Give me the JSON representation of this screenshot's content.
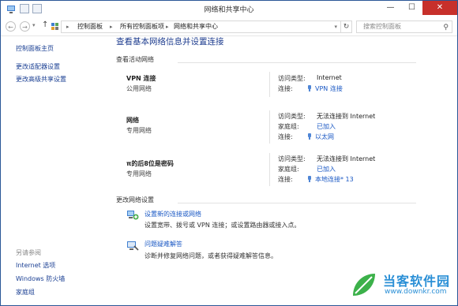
{
  "window": {
    "title": "网络和共享中心",
    "minimize_glyph": "—",
    "maximize_glyph": "☐",
    "close_glyph": "✕"
  },
  "nav": {
    "back_glyph": "←",
    "forward_glyph": "→",
    "up_glyph": "↑",
    "recent_glyph": "▾"
  },
  "address": {
    "crumbs": [
      "控制面板",
      "所有控制面板项",
      "网络和共享中心"
    ],
    "separator": "▸",
    "dropdown_glyph": "▾",
    "refresh_glyph": "↻"
  },
  "search": {
    "placeholder": "搜索控制面板",
    "icon": "search-icon",
    "glyph": "⚲"
  },
  "sidebar": {
    "items": [
      {
        "label": "控制面板主页"
      },
      {
        "label": "更改适配器设置"
      },
      {
        "label": "更改高级共享设置"
      }
    ],
    "see_also": {
      "title": "另请参阅",
      "items": [
        {
          "label": "Internet 选项"
        },
        {
          "label": "Windows 防火墙"
        },
        {
          "label": "家庭组"
        }
      ]
    }
  },
  "main": {
    "title": "查看基本网络信息并设置连接",
    "active_networks_header": "查看活动网络",
    "networks": [
      {
        "name": "VPN 连接",
        "type": "公用网络",
        "props": [
          {
            "label": "访问类型:",
            "value": "Internet",
            "link": false
          },
          {
            "label": "连接:",
            "value": "VPN 连接",
            "link": true,
            "icon": "connection-icon"
          }
        ]
      },
      {
        "name": "网络",
        "type": "专用网络",
        "props": [
          {
            "label": "访问类型:",
            "value": "无法连接到 Internet",
            "link": false
          },
          {
            "label": "家庭组:",
            "value": "已加入",
            "link": true
          },
          {
            "label": "连接:",
            "value": "以太网",
            "link": true,
            "icon": "connection-icon"
          }
        ]
      },
      {
        "name": "π的后8位是密码",
        "type": "专用网络",
        "props": [
          {
            "label": "访问类型:",
            "value": "无法连接到 Internet",
            "link": false
          },
          {
            "label": "家庭组:",
            "value": "已加入",
            "link": true
          },
          {
            "label": "连接:",
            "value": "本地连接* 13",
            "link": true,
            "icon": "connection-icon"
          }
        ]
      }
    ],
    "change_settings_header": "更改网络设置",
    "tasks": [
      {
        "link": "设置新的连接或网络",
        "desc": "设置宽带、拨号或 VPN 连接；或设置路由器或接入点。",
        "icon": "network-setup-icon"
      },
      {
        "link": "问题疑难解答",
        "desc": "诊断并修复网络问题，或者获得疑难解答信息。",
        "icon": "troubleshoot-icon"
      }
    ]
  },
  "watermark": {
    "name": "当客软件园",
    "url": "www.downkr.com"
  },
  "colors": {
    "link": "#1a58c4",
    "title_blue": "#1e3d8f",
    "close_red": "#c7302b",
    "watermark": "#2a8fd6"
  }
}
